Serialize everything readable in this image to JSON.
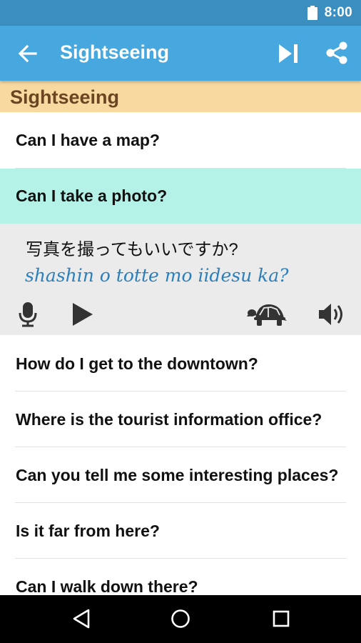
{
  "status": {
    "time": "8:00"
  },
  "app_bar": {
    "title": "Sightseeing"
  },
  "section": {
    "label": "Sightseeing"
  },
  "phrases": [
    {
      "text": "Can I have a map?"
    },
    {
      "text": "Can I take a photo?"
    },
    {
      "text": "How do I get to the downtown?"
    },
    {
      "text": "Where is the tourist information office?"
    },
    {
      "text": "Can you tell me some interesting places?"
    },
    {
      "text": "Is it far from here?"
    },
    {
      "text": "Can I walk down there?"
    }
  ],
  "detail": {
    "native": "写真を撮ってもいいですか?",
    "romanization": "shashin o totte mo iidesu ka?"
  },
  "colors": {
    "status_bar": "#3b8ec0",
    "app_bar": "#46a8de",
    "section_header": "#f8d9a0",
    "selected_row": "#b4f1e7",
    "romanization": "#2a7fbd"
  },
  "icons": {
    "back": "arrow-left",
    "skip": "skip-next",
    "share": "share",
    "record": "microphone",
    "play": "play",
    "slow": "turtle",
    "volume": "speaker"
  }
}
